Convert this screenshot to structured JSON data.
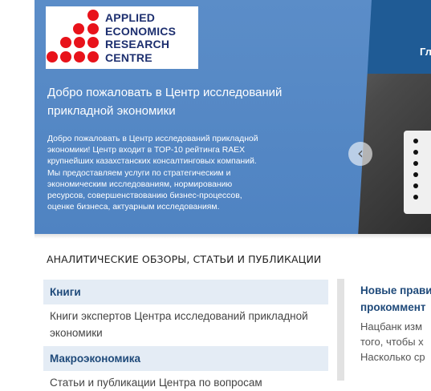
{
  "logo": {
    "lines": [
      "APPLIED",
      "ECONOMICS",
      "RESEARCH",
      "CENTRE"
    ]
  },
  "nav": {
    "partial_item": "Гл"
  },
  "hero": {
    "title": "Добро пожаловать в Центр исследований прикладной экономики",
    "text": "Добро пожаловать в Центр исследований прикладной экономики! Центр входит в ТОР-10 рейтинга RAEX крупнейших казахстанских консалтинговых компаний. Мы предоставляем услуги по стратегическим и экономическим исследованиям, нормированию ресурсов, совершенствованию бизнес-процессов, оценке бизнеса, актуарным исследованиям.",
    "prev_icon": "chevron-left-icon"
  },
  "section": {
    "title": "АНАЛИТИЧЕСКИЕ ОБЗОРЫ, СТАТЬИ И ПУБЛИКАЦИИ"
  },
  "cards": [
    {
      "title": "Книги",
      "text": "Книги экспертов Центра исследований прикладной экономики"
    },
    {
      "title": "Макроэкономика",
      "text": "Статьи и публикации Центра по вопросам"
    }
  ],
  "news": {
    "title_lines": [
      "Новые прави",
      "прокоммент"
    ],
    "text_lines": [
      "Нацбанк изм",
      "того, чтобы х",
      "Насколько ср"
    ]
  },
  "colors": {
    "panel": "#5189c5",
    "logo_ball": "#e8121a",
    "logo_text": "#1d2f6f",
    "link": "#1f4a7a",
    "card_head_bg": "#e4ecf5"
  }
}
